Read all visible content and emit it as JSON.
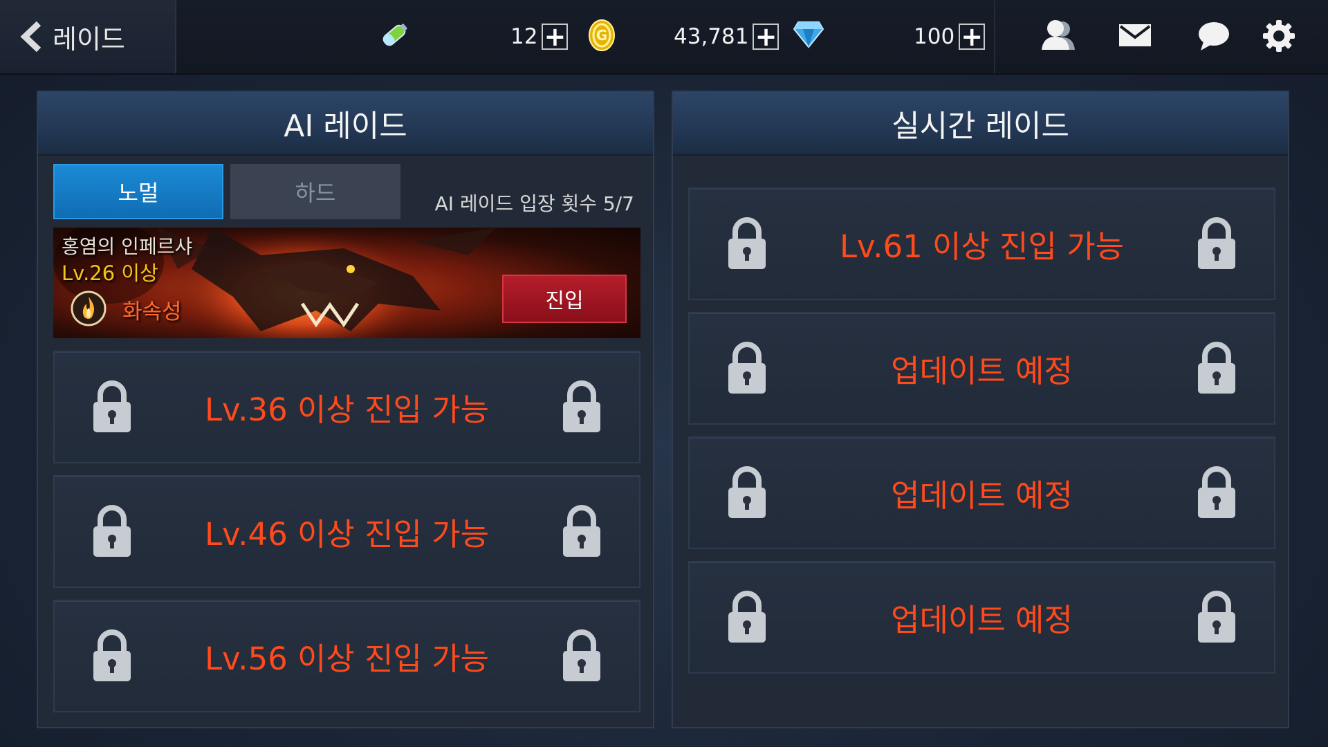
{
  "topbar": {
    "back_title": "레이드",
    "stamina": {
      "value": "12",
      "icon": "energy-potion-icon"
    },
    "gold": {
      "value": "43,781",
      "icon": "gold-coin-icon"
    },
    "gems": {
      "value": "100",
      "icon": "diamond-icon"
    },
    "icons": [
      "friends-icon",
      "mail-icon",
      "chat-icon",
      "settings-gear-icon"
    ]
  },
  "ai_raid": {
    "title": "AI 레이드",
    "tabs": [
      {
        "label": "노멀",
        "active": true
      },
      {
        "label": "하드",
        "active": false
      }
    ],
    "entry_count": "AI 레이드 입장 횟수 5/7",
    "banner": {
      "name": "홍염의 인페르샤",
      "level": "Lv.26 이상",
      "element": "화속성",
      "element_icon": "fire-element-icon",
      "enter_label": "진입"
    },
    "locked": [
      {
        "text": "Lv.36 이상 진입 가능"
      },
      {
        "text": "Lv.46 이상 진입 가능"
      },
      {
        "text": "Lv.56 이상 진입 가능"
      }
    ]
  },
  "realtime_raid": {
    "title": "실시간 레이드",
    "locked": [
      {
        "text": "Lv.61 이상 진입 가능"
      },
      {
        "text": "업데이트 예정"
      },
      {
        "text": "업데이트 예정"
      },
      {
        "text": "업데이트 예정"
      }
    ]
  },
  "colors": {
    "locked_text": "#ff4a1c",
    "tab_active": "#1c8ad6",
    "enter_button": "#b51d2a",
    "level_gold": "#f5c518"
  }
}
